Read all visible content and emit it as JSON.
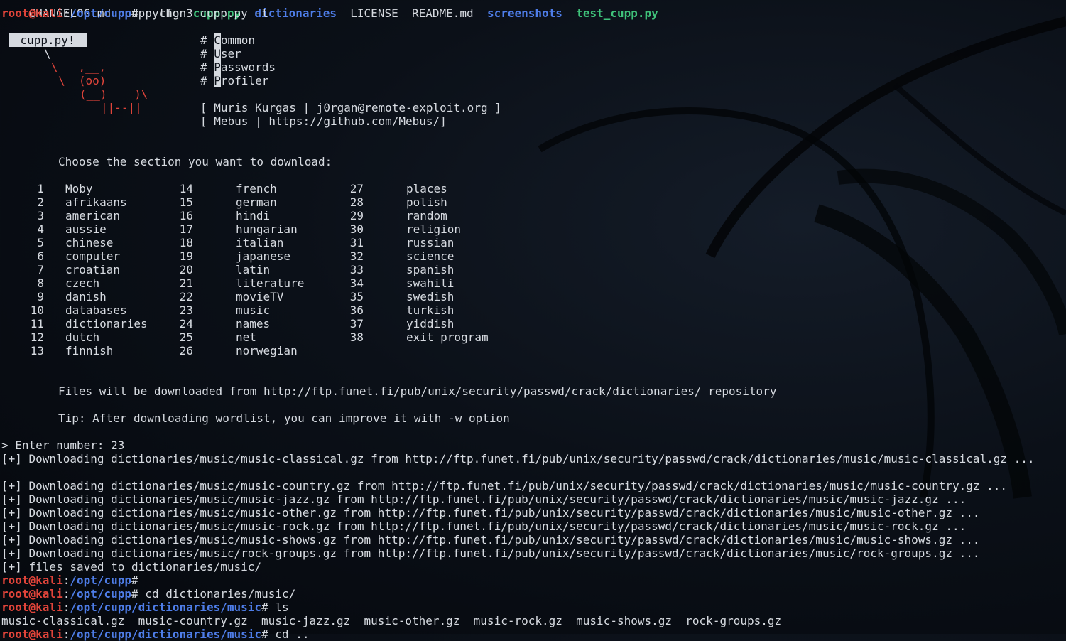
{
  "colors": {
    "prompt_user": "#e0443a",
    "prompt_path": "#4e7de8",
    "dir": "#4e7de8",
    "script": "#3fc27a",
    "text": "#d6dae0",
    "background": "#0b1018"
  },
  "ls_row": [
    {
      "name": "CHANGELOG.md",
      "kind": "file"
    },
    {
      "name": "cupp.cfg",
      "kind": "file"
    },
    {
      "name": "cupp.py",
      "kind": "script"
    },
    {
      "name": "dictionaries",
      "kind": "dir"
    },
    {
      "name": "LICENSE",
      "kind": "file"
    },
    {
      "name": "README.md",
      "kind": "file"
    },
    {
      "name": "screenshots",
      "kind": "dir"
    },
    {
      "name": "test_cupp.py",
      "kind": "script"
    }
  ],
  "prompt": {
    "user": "root@kali",
    "sep": ":",
    "hash": "#"
  },
  "cmd1": {
    "path": "/opt/cupp",
    "command": " python3 cupp.py -l"
  },
  "banner": {
    "badge": "cupp.py!",
    "cow": [
      "\\",
      "\\   ,__,",
      "\\  (oo)____",
      "(__)    )\\",
      "||--||"
    ],
    "menu": [
      {
        "prefix": "# ",
        "initial": "C",
        "rest": "ommon"
      },
      {
        "prefix": "# ",
        "initial": "U",
        "rest": "ser"
      },
      {
        "prefix": "# ",
        "initial": "P",
        "rest": "asswords"
      },
      {
        "prefix": "# ",
        "initial": "P",
        "rest": "rofiler"
      }
    ],
    "credit1": "[ Muris Kurgas | j0rgan@remote-exploit.org ]",
    "credit2": "[ Mebus | https://github.com/Mebus/]"
  },
  "choose": "Choose the section you want to download:",
  "sections": {
    "col1": [
      [
        "1",
        "Moby"
      ],
      [
        "2",
        "afrikaans"
      ],
      [
        "3",
        "american"
      ],
      [
        "4",
        "aussie"
      ],
      [
        "5",
        "chinese"
      ],
      [
        "6",
        "computer"
      ],
      [
        "7",
        "croatian"
      ],
      [
        "8",
        "czech"
      ],
      [
        "9",
        "danish"
      ],
      [
        "10",
        "databases"
      ],
      [
        "11",
        "dictionaries"
      ],
      [
        "12",
        "dutch"
      ],
      [
        "13",
        "finnish"
      ]
    ],
    "col2": [
      [
        "14",
        "french"
      ],
      [
        "15",
        "german"
      ],
      [
        "16",
        "hindi"
      ],
      [
        "17",
        "hungarian"
      ],
      [
        "18",
        "italian"
      ],
      [
        "19",
        "japanese"
      ],
      [
        "20",
        "latin"
      ],
      [
        "21",
        "literature"
      ],
      [
        "22",
        "movieTV"
      ],
      [
        "23",
        "music"
      ],
      [
        "24",
        "names"
      ],
      [
        "25",
        "net"
      ],
      [
        "26",
        "norwegian"
      ]
    ],
    "col3": [
      [
        "27",
        "places"
      ],
      [
        "28",
        "polish"
      ],
      [
        "29",
        "random"
      ],
      [
        "30",
        "religion"
      ],
      [
        "31",
        "russian"
      ],
      [
        "32",
        "science"
      ],
      [
        "33",
        "spanish"
      ],
      [
        "34",
        "swahili"
      ],
      [
        "35",
        "swedish"
      ],
      [
        "36",
        "turkish"
      ],
      [
        "37",
        "yiddish"
      ],
      [
        "38",
        "exit program"
      ]
    ]
  },
  "files_from": "Files will be downloaded from http://ftp.funet.fi/pub/unix/security/passwd/crack/dictionaries/ repository",
  "tip": "Tip: After downloading wordlist, you can improve it with -w option",
  "enter": "> Enter number: 23",
  "downloads": [
    "[+] Downloading dictionaries/music/music-classical.gz from http://ftp.funet.fi/pub/unix/security/passwd/crack/dictionaries/music/music-classical.gz ...",
    "",
    "[+] Downloading dictionaries/music/music-country.gz from http://ftp.funet.fi/pub/unix/security/passwd/crack/dictionaries/music/music-country.gz ...",
    "[+] Downloading dictionaries/music/music-jazz.gz from http://ftp.funet.fi/pub/unix/security/passwd/crack/dictionaries/music/music-jazz.gz ...",
    "[+] Downloading dictionaries/music/music-other.gz from http://ftp.funet.fi/pub/unix/security/passwd/crack/dictionaries/music/music-other.gz ...",
    "[+] Downloading dictionaries/music/music-rock.gz from http://ftp.funet.fi/pub/unix/security/passwd/crack/dictionaries/music/music-rock.gz ...",
    "[+] Downloading dictionaries/music/music-shows.gz from http://ftp.funet.fi/pub/unix/security/passwd/crack/dictionaries/music/music-shows.gz ...",
    "[+] Downloading dictionaries/music/rock-groups.gz from http://ftp.funet.fi/pub/unix/security/passwd/crack/dictionaries/music/rock-groups.gz ...",
    "[+] files saved to dictionaries/music/"
  ],
  "prompt_lines": [
    {
      "path": "/opt/cupp",
      "command": ""
    },
    {
      "path": "/opt/cupp",
      "command": " cd dictionaries/music/"
    },
    {
      "path": "/opt/cupp/dictionaries/music",
      "command": " ls"
    }
  ],
  "ls_music": "music-classical.gz  music-country.gz  music-jazz.gz  music-other.gz  music-rock.gz  music-shows.gz  rock-groups.gz",
  "last_prompt": {
    "path": "/opt/cupp/dictionaries/music",
    "command": " cd .."
  }
}
